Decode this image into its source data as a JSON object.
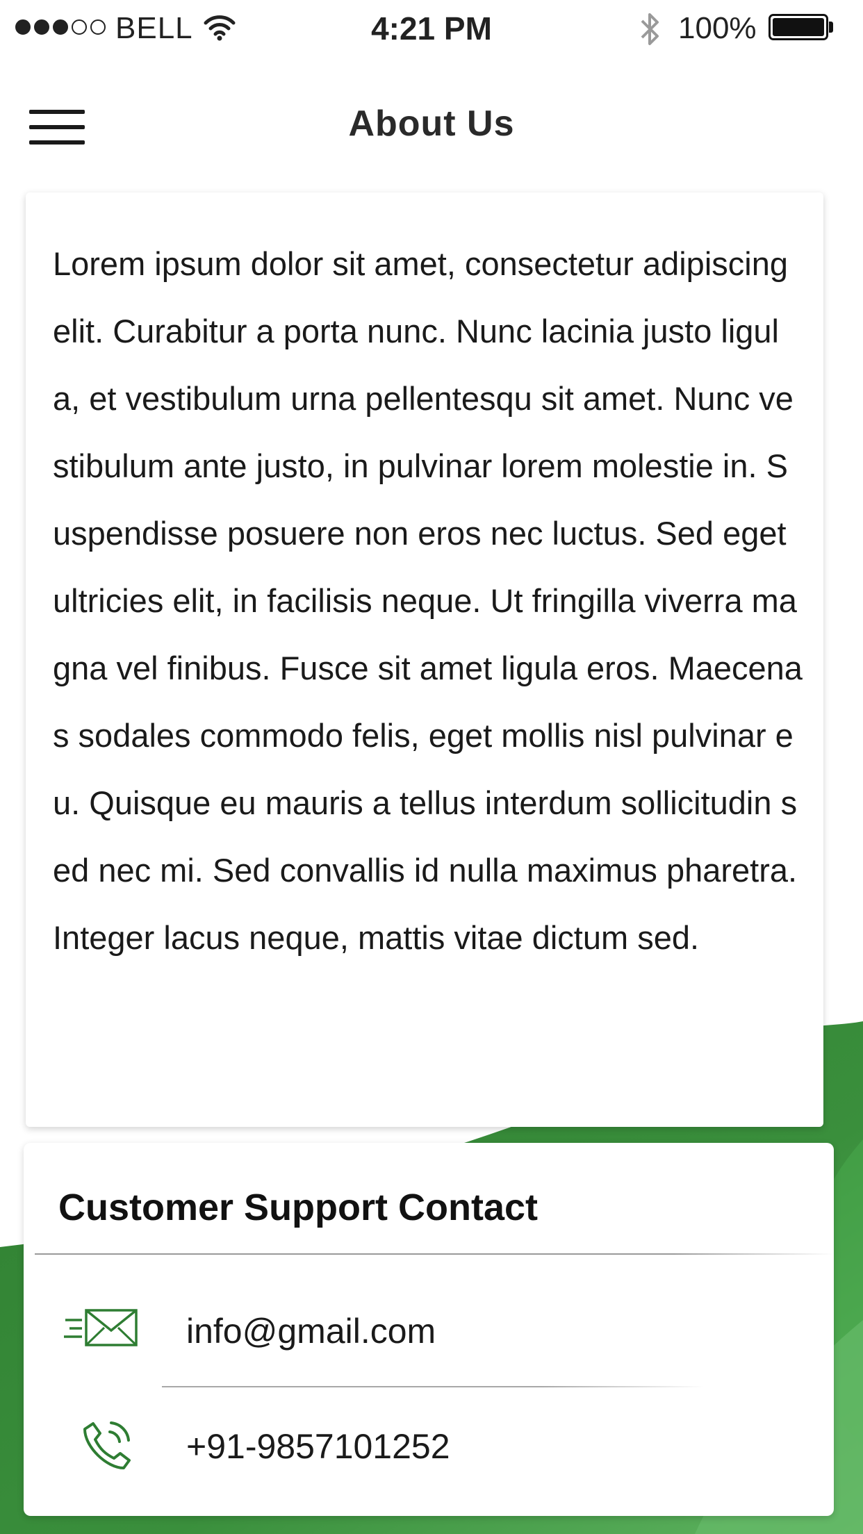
{
  "status_bar": {
    "carrier": "BELL",
    "signal_bars_filled": 3,
    "signal_bars_total": 5,
    "time": "4:21 PM",
    "battery_percent": "100%",
    "battery_level": 1.0,
    "icons": [
      "wifi-icon",
      "bluetooth-icon",
      "battery-icon"
    ]
  },
  "header": {
    "title": "About Us",
    "menu_icon": "hamburger-menu-icon"
  },
  "about": {
    "body": "Lorem ipsum dolor sit amet, consectetur adipiscing elit. Curabitur a porta nunc. Nunc lacinia justo ligula, et vestibulum urna pellentesqu sit amet. Nunc vestibulum ante justo, in pulvinar lorem molestie in. Suspendisse posuere non eros nec luctus. Sed eget ultricies elit, in facilisis neque. Ut fringilla viverra magna vel finibus. Fusce sit amet ligula eros. Maecenas sodales commodo felis, eget mollis nisl pulvinar eu. Quisque eu mauris a tellus interdum sollicitudin sed nec mi. Sed convallis id nulla maximus pharetra. Integer lacus neque, mattis vitae dictum sed."
  },
  "support": {
    "title": "Customer Support Contact",
    "email": {
      "icon": "email-icon",
      "value": "info@gmail.com"
    },
    "phone": {
      "icon": "phone-icon",
      "value": "+91-9857101252"
    }
  },
  "colors": {
    "accent_green": "#2e7d32",
    "wave_light_green": "#66bb6a",
    "text": "#1a1a1a",
    "card_background": "#ffffff"
  }
}
